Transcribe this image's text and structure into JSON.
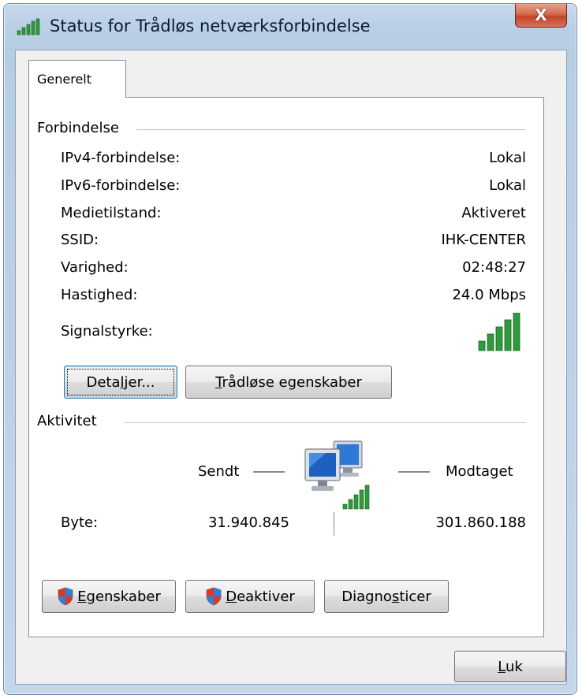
{
  "window": {
    "title": "Status for Trådløs netværksforbindelse",
    "close_label": "X"
  },
  "tabs": [
    {
      "label": "Generelt",
      "active": true
    }
  ],
  "connection": {
    "heading": "Forbindelse",
    "rows": [
      {
        "label": "IPv4-forbindelse:",
        "value": "Lokal"
      },
      {
        "label": "IPv6-forbindelse:",
        "value": "Lokal"
      },
      {
        "label": "Medietilstand:",
        "value": "Aktiveret"
      },
      {
        "label": "SSID:",
        "value": "IHK-CENTER"
      },
      {
        "label": "Varighed:",
        "value": "02:48:27"
      },
      {
        "label": "Hastighed:",
        "value": "24.0 Mbps"
      }
    ],
    "signal_label": "Signalstyrke:",
    "signal_bars": 5,
    "signal_bars_max": 5,
    "buttons": {
      "details_pre": "Deta",
      "details_key": "l",
      "details_post": "jer...",
      "wireless_pre": "",
      "wireless_key": "T",
      "wireless_post": "rådløse egenskaber"
    }
  },
  "activity": {
    "heading": "Aktivitet",
    "sent_label": "Sendt",
    "received_label": "Modtaget",
    "bytes_label": "Byte:",
    "bytes_sent": "31.940.845",
    "bytes_received": "301.860.188"
  },
  "bottom_buttons": {
    "properties_pre": "",
    "properties_key": "E",
    "properties_post": "genskaber",
    "disable_pre": "",
    "disable_key": "D",
    "disable_post": "eaktiver",
    "diagnose_pre": "Diagno",
    "diagnose_key": "s",
    "diagnose_post": "ticer"
  },
  "close_button": {
    "pre": "",
    "key": "L",
    "post": "uk"
  },
  "colors": {
    "signal_green": "#2f9a3a",
    "title_close_red": "#c2432a",
    "monitor_blue": "#1f5fbf"
  }
}
